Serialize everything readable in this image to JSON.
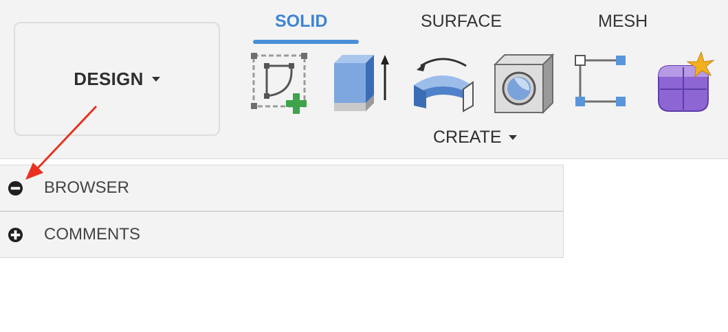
{
  "toolbar": {
    "workspace_label": "DESIGN",
    "tabs": [
      {
        "label": "SOLID",
        "active": true
      },
      {
        "label": "SURFACE",
        "active": false
      },
      {
        "label": "MESH",
        "active": false
      }
    ],
    "tools": [
      {
        "icon": "create-sketch-icon"
      },
      {
        "icon": "extrude-icon"
      },
      {
        "icon": "revolve-icon"
      },
      {
        "icon": "hole-icon"
      },
      {
        "icon": "form-icon"
      },
      {
        "icon": "derive-icon"
      }
    ],
    "group_label": "CREATE"
  },
  "panels": [
    {
      "label": "BROWSER",
      "state": "expanded",
      "icon": "minus-circle-icon"
    },
    {
      "label": "COMMENTS",
      "state": "collapsed",
      "icon": "plus-circle-icon"
    }
  ],
  "annotation": {
    "type": "arrow",
    "color": "#e8311f",
    "target": "browser-collapse-icon"
  },
  "colors": {
    "accent": "#4a8fd8",
    "active_tab_text": "#3d84d3",
    "toolbar_bg": "#f3f3f3",
    "annotation": "#e8311f"
  }
}
